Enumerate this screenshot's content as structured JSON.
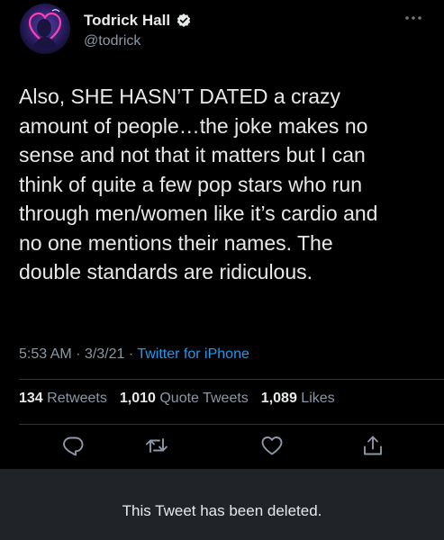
{
  "author": {
    "name": "Todrick Hall",
    "handle": "@todrick",
    "verified_icon": "verified-badge-icon",
    "avatar_icon": "avatar"
  },
  "tweet": {
    "text": "Also, SHE HASN’T DATED a crazy\namount of people…the joke makes no\nsense and not that it matters but I can\nthink of quite a few pop stars who run\nthrough men/women like it’s cardio and\nno one mentions their names. The\ndouble standards are ridiculous.",
    "time": "5:53 AM",
    "date": "3/3/21",
    "separator": "·",
    "source": "Twitter for iPhone"
  },
  "stats": {
    "retweets_count": "134",
    "retweets_label": "Retweets",
    "quotes_count": "1,010",
    "quotes_label": "Quote Tweets",
    "likes_count": "1,089",
    "likes_label": "Likes"
  },
  "actions": [
    "reply-icon",
    "retweet-icon",
    "like-icon",
    "share-icon"
  ],
  "banner": {
    "text": "This Tweet has been deleted."
  },
  "colors": {
    "background": "#000000",
    "text": "#e7e9ea",
    "secondary": "#8b98a5",
    "link": "#1d9bf0",
    "banner": "#202327"
  }
}
